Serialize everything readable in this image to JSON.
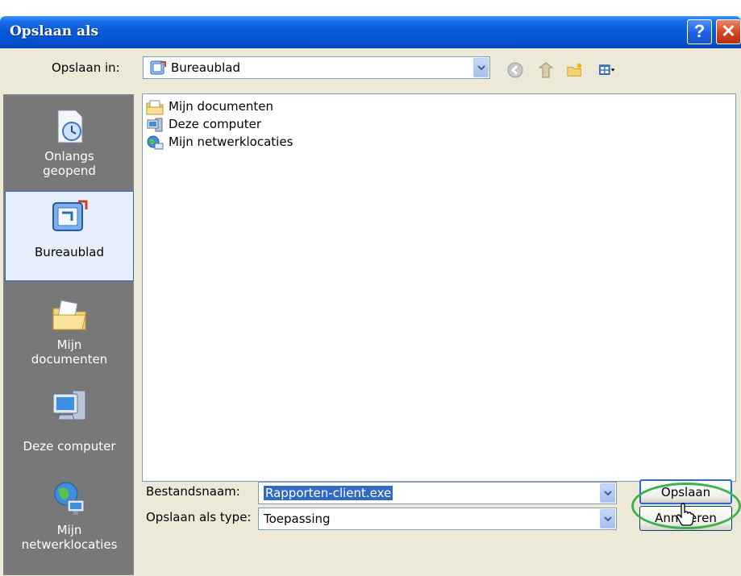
{
  "window": {
    "title": "Opslaan als",
    "help_icon": "?",
    "close_icon": "✕"
  },
  "toolbar": {
    "save_in_label": "Opslaan in:",
    "location": "Bureaublad",
    "icons": [
      "back-icon",
      "up-folder-icon",
      "new-folder-icon",
      "view-menu-icon"
    ]
  },
  "places": [
    {
      "label_line1": "Onlangs",
      "label_line2": "geopend",
      "icon": "recent-documents-icon"
    },
    {
      "label_line1": "Bureaublad",
      "label_line2": "",
      "icon": "desktop-icon",
      "selected": true
    },
    {
      "label_line1": "Mijn",
      "label_line2": "documenten",
      "icon": "my-documents-icon"
    },
    {
      "label_line1": "Deze computer",
      "label_line2": "",
      "icon": "my-computer-icon"
    },
    {
      "label_line1": "Mijn",
      "label_line2": "netwerklocaties",
      "icon": "network-places-icon"
    }
  ],
  "files": [
    {
      "name": "Mijn documenten",
      "icon": "documents-folder-icon"
    },
    {
      "name": "Deze computer",
      "icon": "computer-icon"
    },
    {
      "name": "Mijn netwerklocaties",
      "icon": "network-icon"
    }
  ],
  "form": {
    "filename_label": "Bestandsnaam:",
    "filename_value": "Rapporten-client.exe",
    "type_label": "Opslaan als type:",
    "type_value": "Toepassing"
  },
  "buttons": {
    "save": "Opslaan",
    "cancel": "Annuleren"
  },
  "colors": {
    "title_bar": "#0553d1",
    "selection": "#316ac5",
    "highlight_ring": "#3cb34a"
  }
}
